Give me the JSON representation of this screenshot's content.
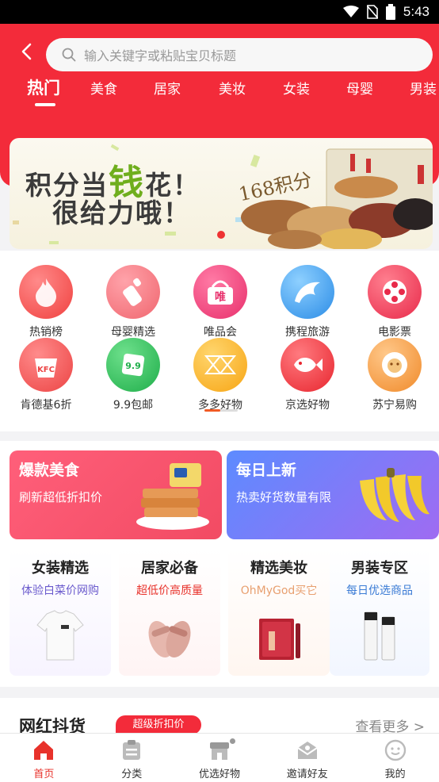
{
  "status_bar": {
    "time": "5:43",
    "icons": [
      "wifi-icon",
      "no-sim-icon",
      "battery-icon"
    ]
  },
  "header": {
    "search": {
      "placeholder": "输入关键字或粘贴宝贝标题"
    },
    "tabs": [
      {
        "label": "热门",
        "active": true
      },
      {
        "label": "美食"
      },
      {
        "label": "居家"
      },
      {
        "label": "美妆"
      },
      {
        "label": "女装"
      },
      {
        "label": "母婴"
      },
      {
        "label": "男装"
      }
    ],
    "accent_color": "#f32b3a"
  },
  "banner": {
    "line1_a": "积分当",
    "line1_hi": "钱",
    "line1_b": "花！",
    "line2": "很给力哦！",
    "badge": "168积分"
  },
  "shortcuts": [
    {
      "label": "热销榜",
      "icon": "flame-icon",
      "color": "#ff5a5a"
    },
    {
      "label": "母婴精选",
      "icon": "baby-bottle-icon",
      "color": "#ff7b88"
    },
    {
      "label": "唯品会",
      "icon": "shopping-basket-icon",
      "glyph": "唯",
      "color": "#f0487b"
    },
    {
      "label": "携程旅游",
      "icon": "dolphin-icon",
      "color": "#3fa3f0"
    },
    {
      "label": "电影票",
      "icon": "film-reel-icon",
      "color": "#f0405a"
    },
    {
      "label": "肯德基6折",
      "icon": "kfc-icon",
      "glyph": "KFC",
      "color": "#f05454"
    },
    {
      "label": "9.9包邮",
      "icon": "price-tag-icon",
      "glyph": "9.9",
      "color": "#2fc25b"
    },
    {
      "label": "多多好物",
      "icon": "gift-pattern-icon",
      "color": "#ffb51e"
    },
    {
      "label": "京选好物",
      "icon": "fish-icon",
      "color": "#f2414a"
    },
    {
      "label": "苏宁易购",
      "icon": "lion-icon",
      "color": "#f7a34b"
    }
  ],
  "promos": [
    {
      "title": "爆款美食",
      "subtitle": "刷新超低折扣价",
      "image": "snack-plate-icon"
    },
    {
      "title": "每日上新",
      "subtitle": "热卖好货数量有限",
      "image": "banana-icon"
    }
  ],
  "categories": [
    {
      "title": "女装精选",
      "subtitle": "体验白菜价网购",
      "sub_color": "#6a5acd",
      "image": "tshirt-icon"
    },
    {
      "title": "居家必备",
      "subtitle": "超低价高质量",
      "sub_color": "#e8322b",
      "image": "slippers-icon"
    },
    {
      "title": "精选美妆",
      "subtitle": "OhMyGod买它",
      "sub_color": "#e8a070",
      "image": "makeup-set-icon"
    },
    {
      "title": "男装专区",
      "subtitle": "每日优选商品",
      "sub_color": "#3a7bd5",
      "image": "skincare-tubes-icon"
    }
  ],
  "trending": {
    "title": "网红抖货",
    "tag": "超级折扣价",
    "more": "查看更多 >"
  },
  "bottom_nav": [
    {
      "label": "首页",
      "icon": "home-icon",
      "active": true
    },
    {
      "label": "分类",
      "icon": "category-icon"
    },
    {
      "label": "优选好物",
      "icon": "store-icon"
    },
    {
      "label": "邀请好友",
      "icon": "invite-icon"
    },
    {
      "label": "我的",
      "icon": "profile-icon"
    }
  ]
}
